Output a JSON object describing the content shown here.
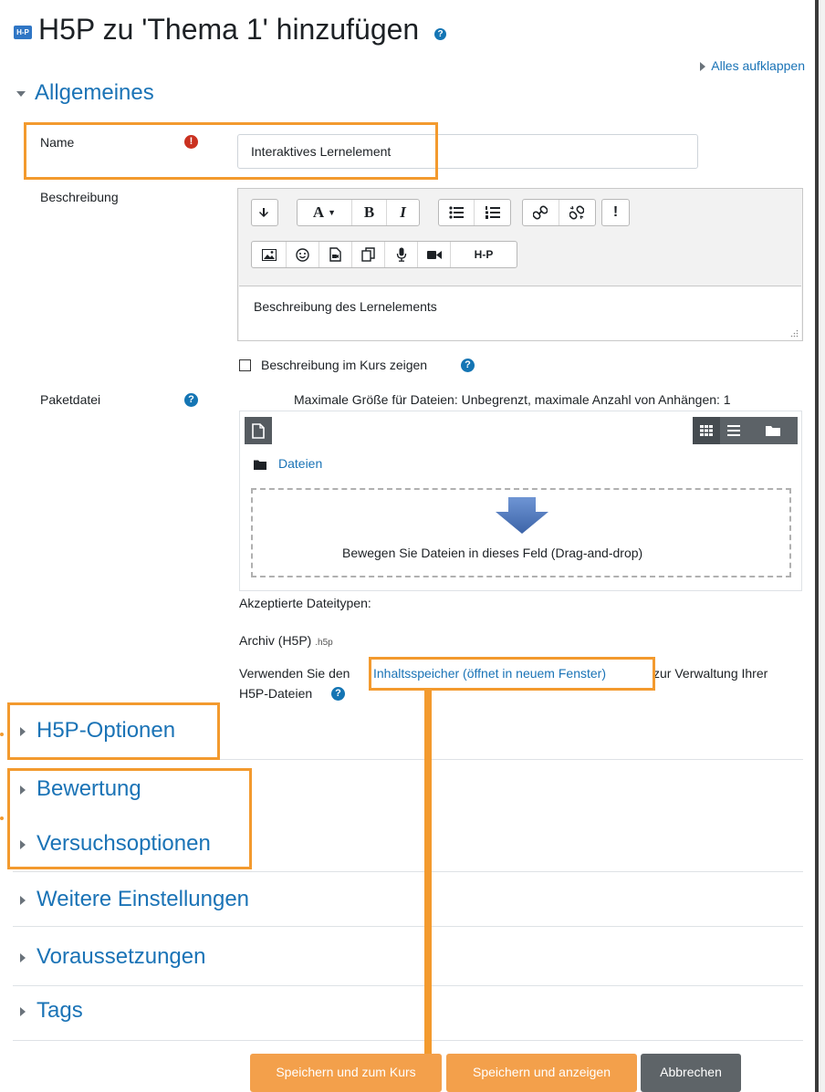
{
  "page": {
    "title": "H5P zu 'Thema 1' hinzufügen",
    "logo_text": "H-P",
    "expand_all": "Alles aufklappen"
  },
  "general": {
    "section_title": "Allgemeines",
    "name_label": "Name",
    "name_value": "Interaktives Lernelement",
    "description_label": "Beschreibung",
    "description_text": "Beschreibung des Lernelements",
    "show_description_label": "Beschreibung im Kurs zeigen",
    "package_label": "Paketdatei",
    "file_limits": "Maximale Größe für Dateien: Unbegrenzt, maximale Anzahl von Anhängen: 1",
    "files_folder": "Dateien",
    "drop_text": "Bewegen Sie Dateien in dieses Feld (Drag-and-drop)",
    "accepted_types_label": "Akzeptierte Dateitypen:",
    "accepted_type": "Archiv (H5P)",
    "accepted_ext": ".h5p",
    "content_bank_prefix": "Verwenden Sie den",
    "content_bank_link": "Inhaltsspeicher (öffnet in neuem Fenster)",
    "content_bank_suffix": "zur Verwaltung Ihrer",
    "content_bank_line2": "H5P-Dateien"
  },
  "toolbar": {
    "row1": [
      "expand-icon",
      "font-size-icon",
      "bold-icon",
      "italic-icon",
      "unordered-list-icon",
      "ordered-list-icon",
      "link-icon",
      "unlink-icon",
      "emoji-alert-icon"
    ],
    "row2": [
      "image-icon",
      "emoji-icon",
      "media-icon",
      "copy-icon",
      "microphone-icon",
      "video-icon",
      "h5p-icon"
    ],
    "bold": "B",
    "italic": "I",
    "font": "A",
    "h5p": "H-P"
  },
  "sections": [
    {
      "title": "H5P-Optionen"
    },
    {
      "title": "Bewertung"
    },
    {
      "title": "Versuchsoptionen"
    },
    {
      "title": "Weitere Einstellungen"
    },
    {
      "title": "Voraussetzungen"
    },
    {
      "title": "Tags"
    }
  ],
  "buttons": {
    "save_return": "Speichern und zum Kurs",
    "save_display": "Speichern und anzeigen",
    "cancel": "Abbrechen"
  },
  "colors": {
    "accent": "#1a73b6",
    "highlight": "#f39a2e",
    "required": "#ca3120",
    "button_orange": "#f3a04b",
    "button_grey": "#5e6468"
  }
}
